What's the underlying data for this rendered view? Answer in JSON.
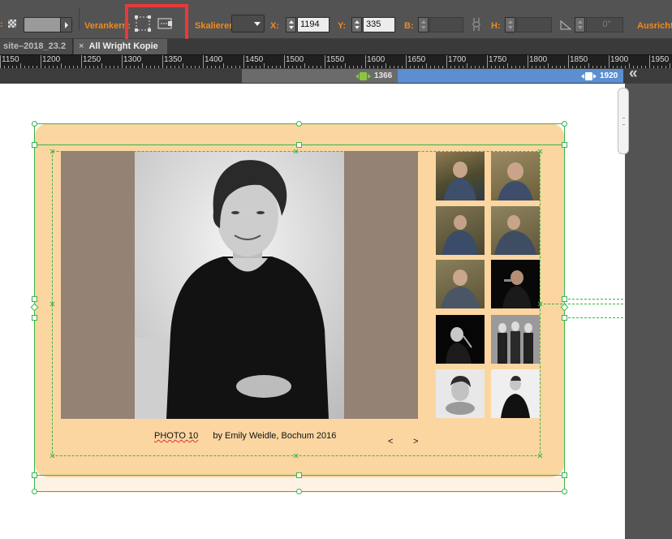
{
  "control_bar": {
    "anchor_label": "Verankern:",
    "scale_label": "Skalieren:",
    "x_label": "X:",
    "x_value": "1194",
    "y_label": "Y:",
    "y_value": "335",
    "b_label": "B:",
    "h_label": "H:",
    "rotation_value": "0°",
    "align_label": "Ausricht",
    "anchor_icons": [
      "anchor-pin-all-icon",
      "anchor-pin-horizontal-icon"
    ]
  },
  "tabs": [
    {
      "label": "site–2018_23.2",
      "active": false
    },
    {
      "label": "All Wright Kopie",
      "active": true,
      "close": "×"
    }
  ],
  "ruler": {
    "labels": [
      "1150",
      "1200",
      "1250",
      "1300",
      "1350",
      "1400",
      "1450",
      "1500",
      "1550",
      "1600",
      "1650",
      "1700",
      "1750",
      "1800",
      "1850",
      "1900",
      "1950"
    ]
  },
  "breakpoints": {
    "first": "1366",
    "second": "1920",
    "collapse_glyph": "«"
  },
  "page": {
    "caption_photo": "PHOTO 10",
    "caption_by": "by Emily Weidle, Bochum 2016",
    "prev": "<",
    "next": ">"
  },
  "colors": {
    "page_bg": "#fbd6a1",
    "photo_brown": "#948274",
    "accent_orange": "#f08a1e",
    "selection_green": "#39b54a",
    "bp_green": "#8cc63f",
    "bp_blue": "#5b8fd0",
    "highlight_red": "#e8393a"
  }
}
